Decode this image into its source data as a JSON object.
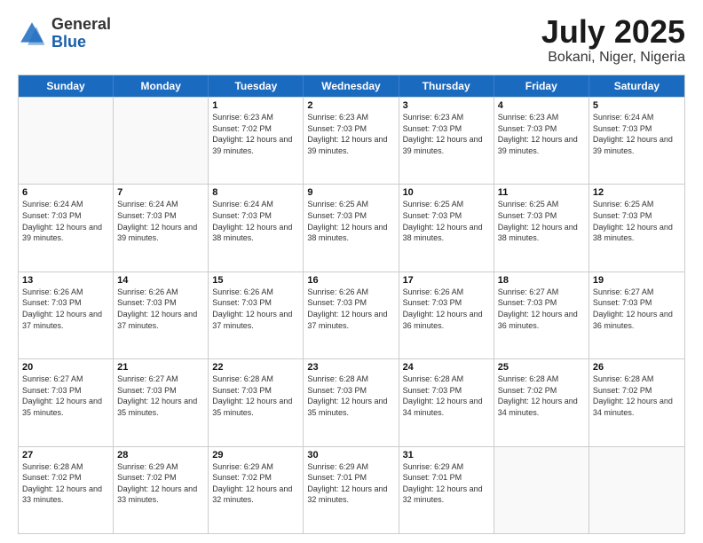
{
  "logo": {
    "general": "General",
    "blue": "Blue"
  },
  "title": {
    "month": "July 2025",
    "location": "Bokani, Niger, Nigeria"
  },
  "header_days": [
    "Sunday",
    "Monday",
    "Tuesday",
    "Wednesday",
    "Thursday",
    "Friday",
    "Saturday"
  ],
  "weeks": [
    [
      {
        "day": "",
        "sunrise": "",
        "sunset": "",
        "daylight": "",
        "empty": true
      },
      {
        "day": "",
        "sunrise": "",
        "sunset": "",
        "daylight": "",
        "empty": true
      },
      {
        "day": "1",
        "sunrise": "Sunrise: 6:23 AM",
        "sunset": "Sunset: 7:02 PM",
        "daylight": "Daylight: 12 hours and 39 minutes.",
        "empty": false
      },
      {
        "day": "2",
        "sunrise": "Sunrise: 6:23 AM",
        "sunset": "Sunset: 7:03 PM",
        "daylight": "Daylight: 12 hours and 39 minutes.",
        "empty": false
      },
      {
        "day": "3",
        "sunrise": "Sunrise: 6:23 AM",
        "sunset": "Sunset: 7:03 PM",
        "daylight": "Daylight: 12 hours and 39 minutes.",
        "empty": false
      },
      {
        "day": "4",
        "sunrise": "Sunrise: 6:23 AM",
        "sunset": "Sunset: 7:03 PM",
        "daylight": "Daylight: 12 hours and 39 minutes.",
        "empty": false
      },
      {
        "day": "5",
        "sunrise": "Sunrise: 6:24 AM",
        "sunset": "Sunset: 7:03 PM",
        "daylight": "Daylight: 12 hours and 39 minutes.",
        "empty": false
      }
    ],
    [
      {
        "day": "6",
        "sunrise": "Sunrise: 6:24 AM",
        "sunset": "Sunset: 7:03 PM",
        "daylight": "Daylight: 12 hours and 39 minutes.",
        "empty": false
      },
      {
        "day": "7",
        "sunrise": "Sunrise: 6:24 AM",
        "sunset": "Sunset: 7:03 PM",
        "daylight": "Daylight: 12 hours and 39 minutes.",
        "empty": false
      },
      {
        "day": "8",
        "sunrise": "Sunrise: 6:24 AM",
        "sunset": "Sunset: 7:03 PM",
        "daylight": "Daylight: 12 hours and 38 minutes.",
        "empty": false
      },
      {
        "day": "9",
        "sunrise": "Sunrise: 6:25 AM",
        "sunset": "Sunset: 7:03 PM",
        "daylight": "Daylight: 12 hours and 38 minutes.",
        "empty": false
      },
      {
        "day": "10",
        "sunrise": "Sunrise: 6:25 AM",
        "sunset": "Sunset: 7:03 PM",
        "daylight": "Daylight: 12 hours and 38 minutes.",
        "empty": false
      },
      {
        "day": "11",
        "sunrise": "Sunrise: 6:25 AM",
        "sunset": "Sunset: 7:03 PM",
        "daylight": "Daylight: 12 hours and 38 minutes.",
        "empty": false
      },
      {
        "day": "12",
        "sunrise": "Sunrise: 6:25 AM",
        "sunset": "Sunset: 7:03 PM",
        "daylight": "Daylight: 12 hours and 38 minutes.",
        "empty": false
      }
    ],
    [
      {
        "day": "13",
        "sunrise": "Sunrise: 6:26 AM",
        "sunset": "Sunset: 7:03 PM",
        "daylight": "Daylight: 12 hours and 37 minutes.",
        "empty": false
      },
      {
        "day": "14",
        "sunrise": "Sunrise: 6:26 AM",
        "sunset": "Sunset: 7:03 PM",
        "daylight": "Daylight: 12 hours and 37 minutes.",
        "empty": false
      },
      {
        "day": "15",
        "sunrise": "Sunrise: 6:26 AM",
        "sunset": "Sunset: 7:03 PM",
        "daylight": "Daylight: 12 hours and 37 minutes.",
        "empty": false
      },
      {
        "day": "16",
        "sunrise": "Sunrise: 6:26 AM",
        "sunset": "Sunset: 7:03 PM",
        "daylight": "Daylight: 12 hours and 37 minutes.",
        "empty": false
      },
      {
        "day": "17",
        "sunrise": "Sunrise: 6:26 AM",
        "sunset": "Sunset: 7:03 PM",
        "daylight": "Daylight: 12 hours and 36 minutes.",
        "empty": false
      },
      {
        "day": "18",
        "sunrise": "Sunrise: 6:27 AM",
        "sunset": "Sunset: 7:03 PM",
        "daylight": "Daylight: 12 hours and 36 minutes.",
        "empty": false
      },
      {
        "day": "19",
        "sunrise": "Sunrise: 6:27 AM",
        "sunset": "Sunset: 7:03 PM",
        "daylight": "Daylight: 12 hours and 36 minutes.",
        "empty": false
      }
    ],
    [
      {
        "day": "20",
        "sunrise": "Sunrise: 6:27 AM",
        "sunset": "Sunset: 7:03 PM",
        "daylight": "Daylight: 12 hours and 35 minutes.",
        "empty": false
      },
      {
        "day": "21",
        "sunrise": "Sunrise: 6:27 AM",
        "sunset": "Sunset: 7:03 PM",
        "daylight": "Daylight: 12 hours and 35 minutes.",
        "empty": false
      },
      {
        "day": "22",
        "sunrise": "Sunrise: 6:28 AM",
        "sunset": "Sunset: 7:03 PM",
        "daylight": "Daylight: 12 hours and 35 minutes.",
        "empty": false
      },
      {
        "day": "23",
        "sunrise": "Sunrise: 6:28 AM",
        "sunset": "Sunset: 7:03 PM",
        "daylight": "Daylight: 12 hours and 35 minutes.",
        "empty": false
      },
      {
        "day": "24",
        "sunrise": "Sunrise: 6:28 AM",
        "sunset": "Sunset: 7:03 PM",
        "daylight": "Daylight: 12 hours and 34 minutes.",
        "empty": false
      },
      {
        "day": "25",
        "sunrise": "Sunrise: 6:28 AM",
        "sunset": "Sunset: 7:02 PM",
        "daylight": "Daylight: 12 hours and 34 minutes.",
        "empty": false
      },
      {
        "day": "26",
        "sunrise": "Sunrise: 6:28 AM",
        "sunset": "Sunset: 7:02 PM",
        "daylight": "Daylight: 12 hours and 34 minutes.",
        "empty": false
      }
    ],
    [
      {
        "day": "27",
        "sunrise": "Sunrise: 6:28 AM",
        "sunset": "Sunset: 7:02 PM",
        "daylight": "Daylight: 12 hours and 33 minutes.",
        "empty": false
      },
      {
        "day": "28",
        "sunrise": "Sunrise: 6:29 AM",
        "sunset": "Sunset: 7:02 PM",
        "daylight": "Daylight: 12 hours and 33 minutes.",
        "empty": false
      },
      {
        "day": "29",
        "sunrise": "Sunrise: 6:29 AM",
        "sunset": "Sunset: 7:02 PM",
        "daylight": "Daylight: 12 hours and 32 minutes.",
        "empty": false
      },
      {
        "day": "30",
        "sunrise": "Sunrise: 6:29 AM",
        "sunset": "Sunset: 7:01 PM",
        "daylight": "Daylight: 12 hours and 32 minutes.",
        "empty": false
      },
      {
        "day": "31",
        "sunrise": "Sunrise: 6:29 AM",
        "sunset": "Sunset: 7:01 PM",
        "daylight": "Daylight: 12 hours and 32 minutes.",
        "empty": false
      },
      {
        "day": "",
        "sunrise": "",
        "sunset": "",
        "daylight": "",
        "empty": true
      },
      {
        "day": "",
        "sunrise": "",
        "sunset": "",
        "daylight": "",
        "empty": true
      }
    ]
  ]
}
